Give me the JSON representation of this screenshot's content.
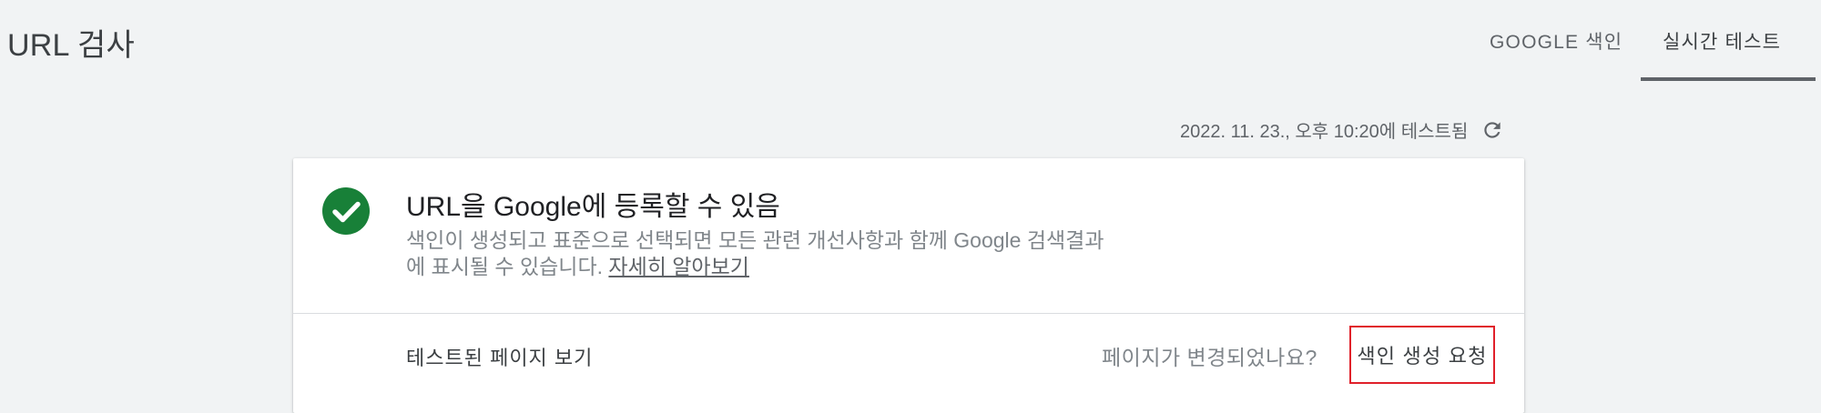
{
  "header": {
    "title": "URL 검사",
    "tabs": [
      {
        "label": "GOOGLE 색인",
        "active": false
      },
      {
        "label": "실시간 테스트",
        "active": true
      }
    ]
  },
  "status": {
    "tested_text": "2022. 11. 23., 오후 10:20에 테스트됨",
    "refresh_icon": "refresh-icon"
  },
  "result": {
    "icon": "check-circle-icon",
    "icon_color": "#188038",
    "title": "URL을 Google에 등록할 수 있음",
    "description_line1": "색인이 생성되고 표준으로 선택되면 모든 관련 개선사항과 함께 Google 검색결과",
    "description_line2": "에 표시될 수 있습니다. ",
    "learn_more": "자세히 알아보기"
  },
  "actions": {
    "view_tested_page": "테스트된 페이지 보기",
    "page_changed_question": "페이지가 변경되었나요?",
    "request_indexing": "색인 생성 요청",
    "highlight_color": "#e0202a"
  }
}
